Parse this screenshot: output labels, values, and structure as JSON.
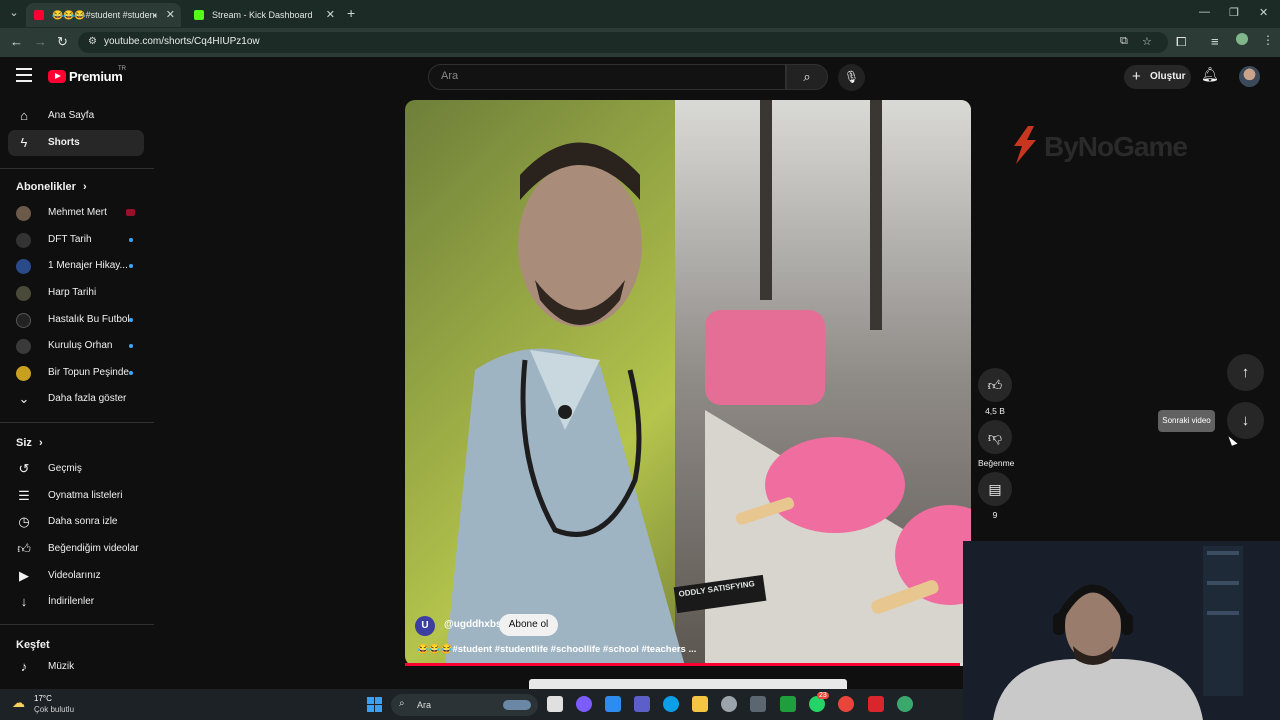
{
  "browser": {
    "tabs": [
      {
        "label": "😂😂😂#student #studen",
        "active": true
      },
      {
        "label": "Stream - Kick Dashboard",
        "active": false
      }
    ],
    "url": "youtube.com/shorts/Cq4HIUPz1ow"
  },
  "header": {
    "logo_text": "Premium",
    "country": "TR",
    "search_placeholder": "Ara",
    "create_label": "Oluştur"
  },
  "sidebar": {
    "main": [
      {
        "label": "Ana Sayfa",
        "icon": "home-icon"
      },
      {
        "label": "Shorts",
        "icon": "shorts-icon",
        "active": true
      }
    ],
    "subscriptions_title": "Abonelikler",
    "subscriptions": [
      {
        "label": "Mehmet Mert",
        "live": true,
        "color": "#6b5a4a"
      },
      {
        "label": "DFT Tarih",
        "dot": true,
        "color": "#333333"
      },
      {
        "label": "1 Menajer Hikay...",
        "dot": true,
        "color": "#2a4a8a"
      },
      {
        "label": "Harp Tarihi",
        "dot": false,
        "color": "#4a4a3a"
      },
      {
        "label": "Hastalık Bu Futbol",
        "dot": true,
        "color": "#222222"
      },
      {
        "label": "Kuruluş Orhan",
        "dot": true,
        "color": "#3a3a3a"
      },
      {
        "label": "Bir Topun Peşinde",
        "dot": true,
        "color": "#c8a020"
      }
    ],
    "show_more": "Daha fazla göster",
    "you_title": "Siz",
    "you": [
      {
        "label": "Geçmiş",
        "icon": "history-icon"
      },
      {
        "label": "Oynatma listeleri",
        "icon": "playlists-icon"
      },
      {
        "label": "Daha sonra izle",
        "icon": "watch-later-icon"
      },
      {
        "label": "Beğendiğim videolar",
        "icon": "liked-icon"
      },
      {
        "label": "Videolarınız",
        "icon": "your-videos-icon"
      },
      {
        "label": "İndirilenler",
        "icon": "downloads-icon"
      }
    ],
    "explore_title": "Keşfet",
    "explore": [
      {
        "label": "Müzik",
        "icon": "music-icon"
      }
    ]
  },
  "short": {
    "channel_initial": "U",
    "channel": "@ugddhxbs",
    "subscribe_label": "Abone ol",
    "title": "😂😂😂#student #studentlife #schoollife #school #teachers ...",
    "progress": 0.98,
    "watermark": "ODDLY SATISFYING",
    "likes": "4,5 B",
    "dislike_label": "Beğenme",
    "comments": "9"
  },
  "nav": {
    "next_tooltip": "Sonraki video"
  },
  "brand": {
    "logo_text": "ByNoGame"
  },
  "taskbar": {
    "temp": "17°C",
    "weather": "Çok bulutlu",
    "search": "Ara",
    "badge": "23"
  },
  "colors": {
    "accent": "#ff0033",
    "link_dot": "#3ea6ff",
    "live": "#9c0f2a"
  }
}
